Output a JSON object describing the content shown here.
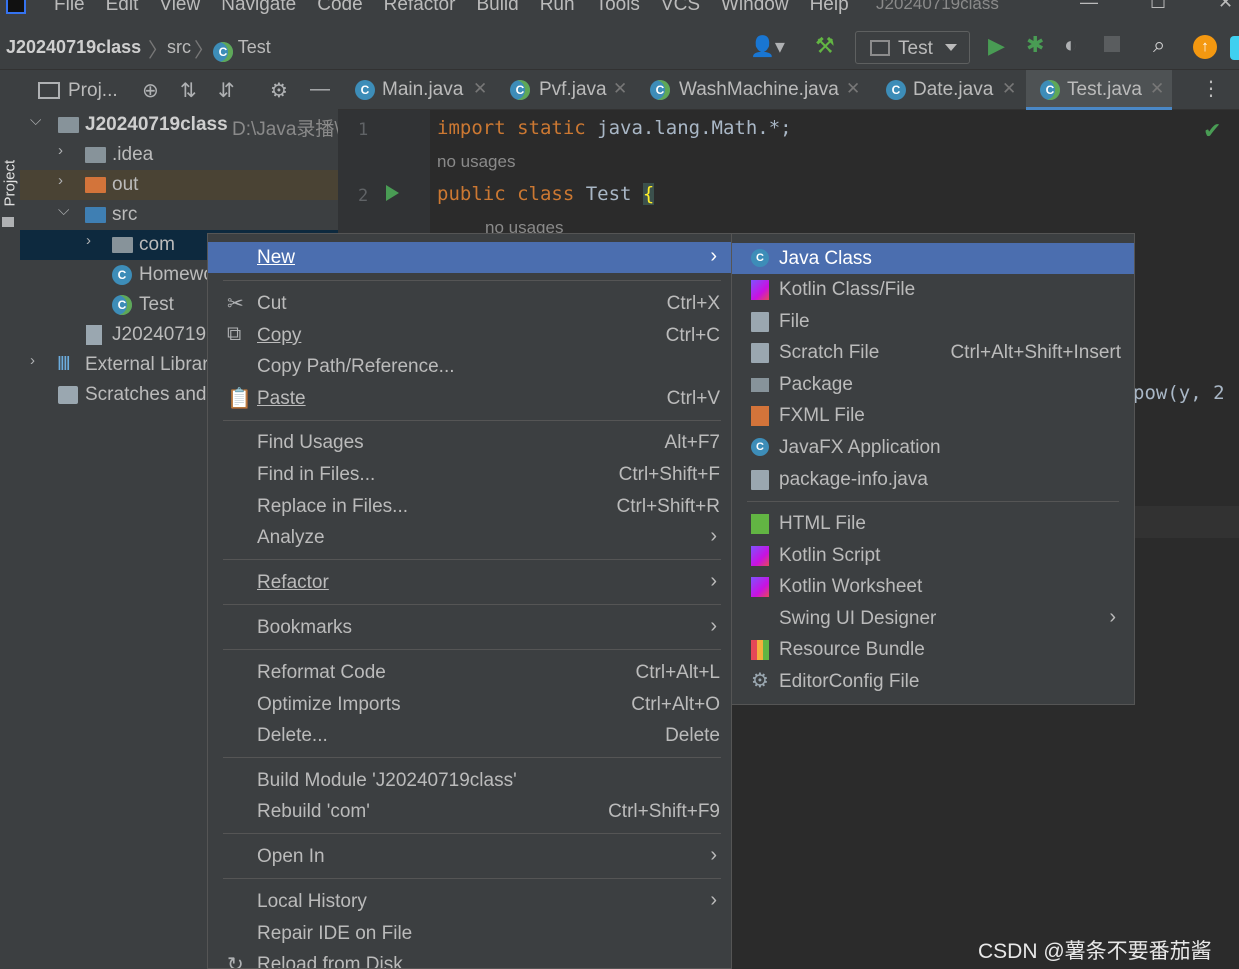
{
  "menubar": {
    "items": [
      "File",
      "Edit",
      "View",
      "Navigate",
      "Code",
      "Refactor",
      "Build",
      "Run",
      "Tools",
      "VCS",
      "Window",
      "Help"
    ],
    "window_title": "J20240719class"
  },
  "navbar": {
    "breadcrumbs": [
      "J20240719class",
      "src",
      "Test"
    ],
    "run_config": "Test"
  },
  "stripe": {
    "label": "Project"
  },
  "project_panel": {
    "title": "Proj...",
    "tree": [
      {
        "label": "J20240719class",
        "sub": "D:\\Java录播\\"
      },
      {
        "label": ".idea"
      },
      {
        "label": "out"
      },
      {
        "label": "src"
      },
      {
        "label": "com"
      },
      {
        "label": "Homewo"
      },
      {
        "label": "Test"
      },
      {
        "label": "J20240719"
      },
      {
        "label": "External Librar"
      },
      {
        "label": "Scratches and"
      }
    ]
  },
  "editor": {
    "tabs": [
      "Main.java",
      "Pvf.java",
      "WashMachine.java",
      "Date.java",
      "Test.java"
    ],
    "active_tab": "Test.java",
    "lines": {
      "l1": "1",
      "l2": "2"
    },
    "code": {
      "import_kw": "import static",
      "import_rest": " java.lang.Math.*;",
      "class_kw": "public class",
      "class_name": " Test ",
      "brace": "{",
      "pow": "pow(y, 2"
    },
    "hints": {
      "h1": "no usages",
      "h2": "no usages"
    }
  },
  "context_menu": {
    "new": "New",
    "cut": {
      "label": "Cut",
      "shortcut": "Ctrl+X"
    },
    "copy": {
      "label": "Copy",
      "shortcut": "Ctrl+C"
    },
    "copy_path": {
      "label": "Copy Path/Reference..."
    },
    "paste": {
      "label": "Paste",
      "shortcut": "Ctrl+V"
    },
    "find_usages": {
      "label": "Find Usages",
      "shortcut": "Alt+F7"
    },
    "find_in_files": {
      "label": "Find in Files...",
      "shortcut": "Ctrl+Shift+F"
    },
    "replace_in_files": {
      "label": "Replace in Files...",
      "shortcut": "Ctrl+Shift+R"
    },
    "analyze": {
      "label": "Analyze"
    },
    "refactor": {
      "label": "Refactor"
    },
    "bookmarks": {
      "label": "Bookmarks"
    },
    "reformat": {
      "label": "Reformat Code",
      "shortcut": "Ctrl+Alt+L"
    },
    "optimize": {
      "label": "Optimize Imports",
      "shortcut": "Ctrl+Alt+O"
    },
    "delete": {
      "label": "Delete...",
      "shortcut": "Delete"
    },
    "build_module": {
      "label": "Build Module 'J20240719class'"
    },
    "rebuild": {
      "label": "Rebuild 'com'",
      "shortcut": "Ctrl+Shift+F9"
    },
    "open_in": {
      "label": "Open In"
    },
    "local_history": {
      "label": "Local History"
    },
    "repair_ide": {
      "label": "Repair IDE on File"
    },
    "reload": {
      "label": "Reload from Disk"
    }
  },
  "new_submenu": {
    "java_class": "Java Class",
    "kotlin_class": "Kotlin Class/File",
    "file": "File",
    "scratch": {
      "label": "Scratch File",
      "shortcut": "Ctrl+Alt+Shift+Insert"
    },
    "package": "Package",
    "fxml": "FXML File",
    "javafx": "JavaFX Application",
    "package_info": "package-info.java",
    "html": "HTML File",
    "kotlin_script": "Kotlin Script",
    "kotlin_worksheet": "Kotlin Worksheet",
    "swing": "Swing UI Designer",
    "resource_bundle": "Resource Bundle",
    "editorconfig": "EditorConfig File"
  },
  "watermark": "CSDN @薯条不要番茄酱",
  "colors": {
    "highlight": "#4b6eaf",
    "background": "#2b2b2b",
    "panel": "#3c3f41"
  }
}
